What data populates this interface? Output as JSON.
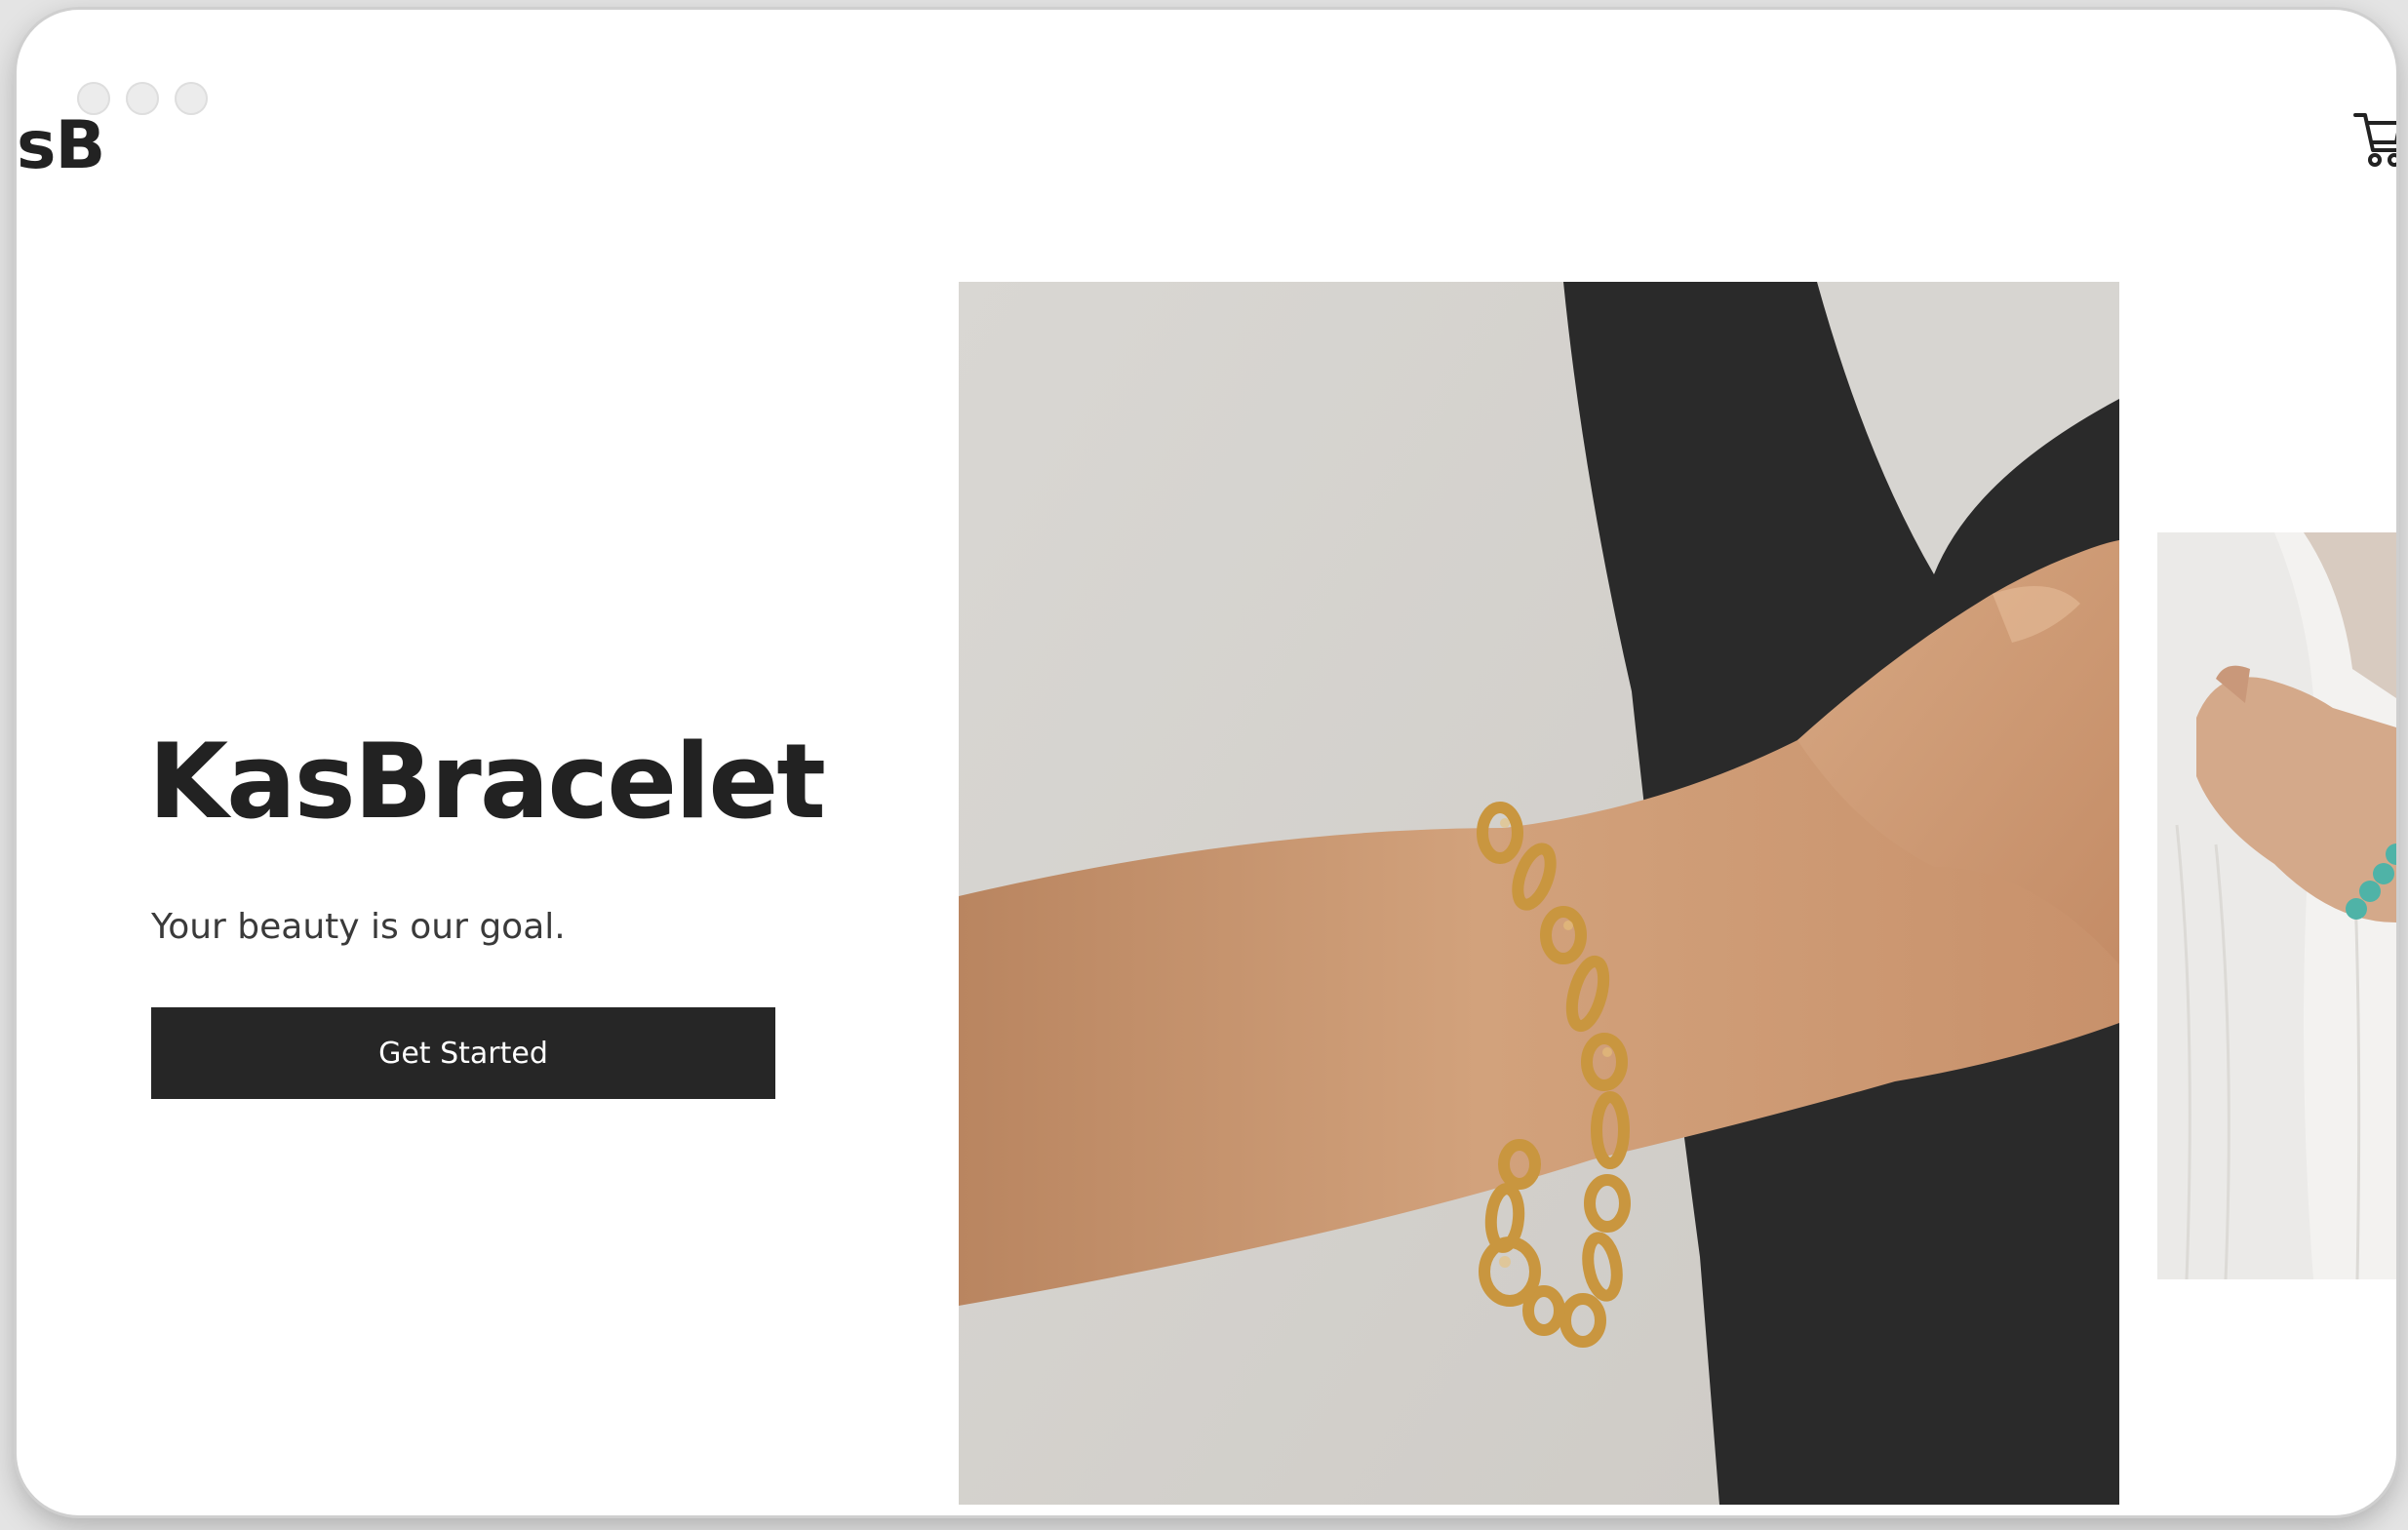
{
  "brand": {
    "logo_text": "sB",
    "title": "KasBracelet",
    "tagline": "Your beauty is our goal."
  },
  "header": {
    "cart_icon": "shopping-cart-icon"
  },
  "hero": {
    "cta_label": "Get Started"
  },
  "images": {
    "main": "photo of wrist wearing gold chain bracelet against white and black fabric",
    "side": "photo of hand wearing turquoise bead bracelet against white shirt"
  },
  "colors": {
    "text": "#222222",
    "button_bg": "#262626",
    "button_text": "#ffffff",
    "gold": "#c9963f",
    "turquoise": "#4fb3a7"
  }
}
